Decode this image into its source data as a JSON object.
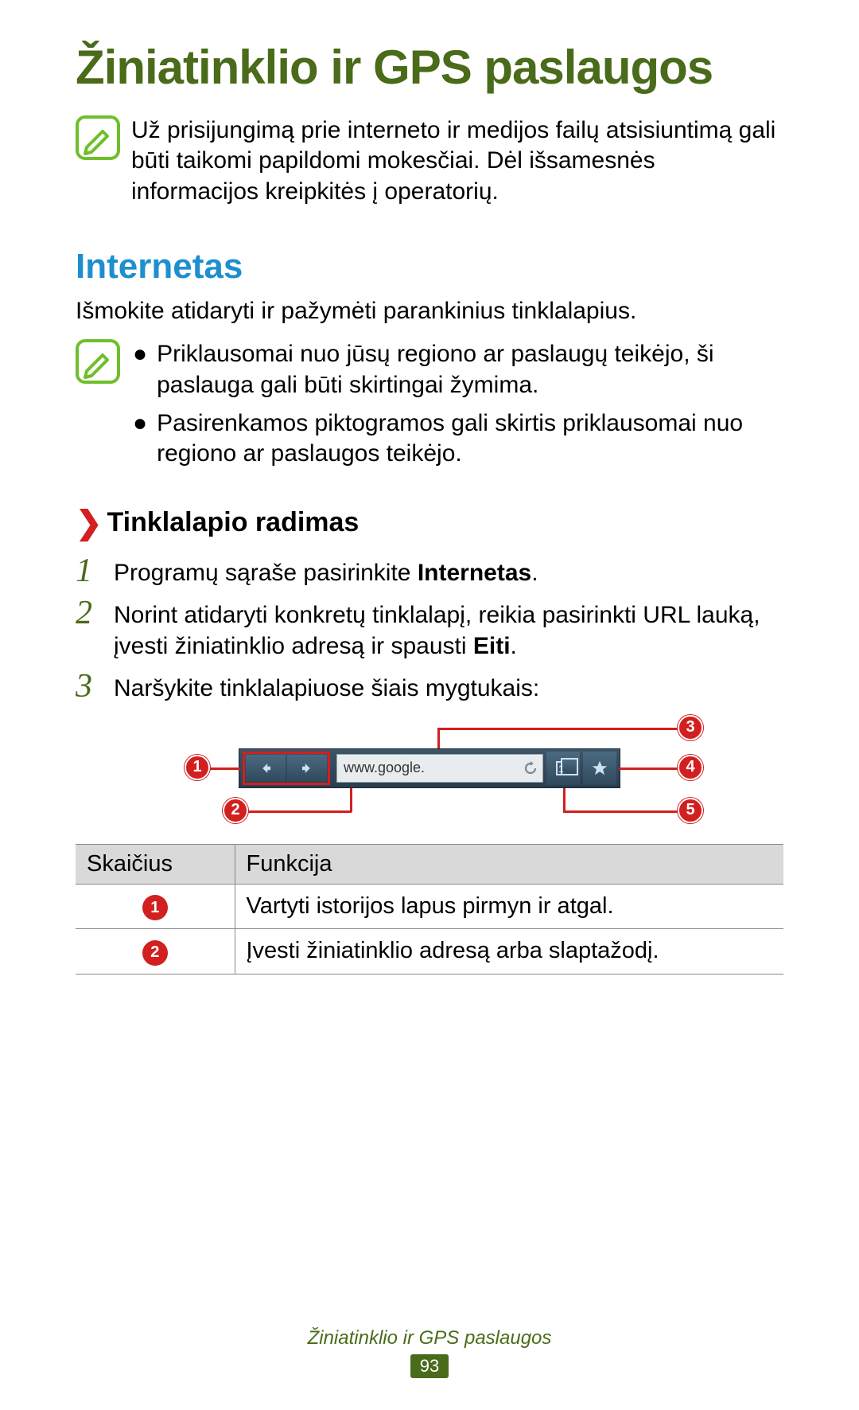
{
  "page": {
    "title": "Žiniatinklio ir GPS paslaugos",
    "top_note": "Už prisijungimą prie interneto ir medijos failų atsisiuntimą gali būti taikomi papildomi mokesčiai. Dėl išsamesnės informacijos kreipkitės į operatorių.",
    "section_title": "Internetas",
    "section_intro": "Išmokite atidaryti ir pažymėti parankinius tinklalapius.",
    "note_bullets": [
      "Priklausomai nuo jūsų regiono ar paslaugų teikėjo, ši paslauga gali būti skirtingai žymima.",
      "Pasirenkamos piktogramos gali skirtis priklausomai nuo regiono ar paslaugos teikėjo."
    ],
    "sub_heading": "Tinklalapio radimas",
    "steps": {
      "s1_pre": "Programų sąraše pasirinkite ",
      "s1_bold": "Internetas",
      "s1_post": ".",
      "s2_pre": "Norint atidaryti konkretų tinklalapį, reikia pasirinkti URL lauką, įvesti žiniatinklio adresą ir spausti ",
      "s2_bold": "Eiti",
      "s2_post": ".",
      "s3": "Naršykite tinklalapiuose šiais mygtukais:"
    },
    "step_nums": {
      "n1": "1",
      "n2": "2",
      "n3": "3"
    },
    "diagram": {
      "url_text": "www.google.",
      "callouts": {
        "c1": "1",
        "c2": "2",
        "c3": "3",
        "c4": "4",
        "c5": "5"
      },
      "windows_count": "1"
    },
    "table": {
      "headers": {
        "col1": "Skaičius",
        "col2": "Funkcija"
      },
      "rows": [
        {
          "num": "1",
          "desc": "Vartyti istorijos lapus pirmyn ir atgal."
        },
        {
          "num": "2",
          "desc": "Įvesti žiniatinklio adresą arba slaptažodį."
        }
      ]
    },
    "footer": {
      "title": "Žiniatinklio ir GPS paslaugos",
      "page_num": "93"
    }
  }
}
